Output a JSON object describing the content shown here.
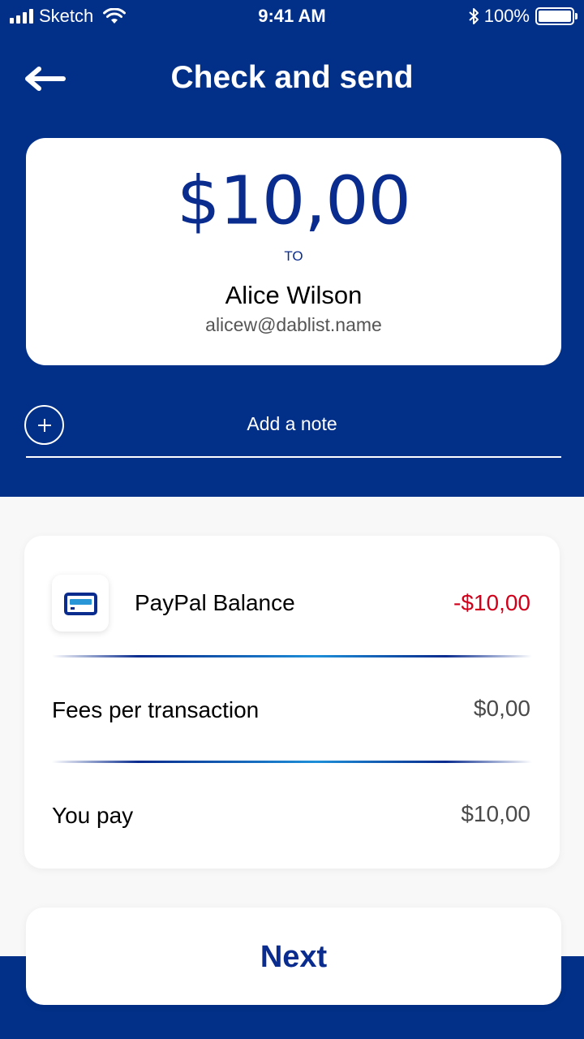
{
  "status_bar": {
    "carrier": "Sketch",
    "time": "9:41 AM",
    "battery": "100%"
  },
  "header": {
    "title": "Check and send",
    "back_icon": "arrow-left-icon"
  },
  "recipient_card": {
    "amount": "$10,00",
    "to_label": "TO",
    "name": "Alice Wilson",
    "email": "alicew@dablist.name"
  },
  "note": {
    "add_icon": "plus-circle-icon",
    "placeholder": "Add a note"
  },
  "payment": {
    "source_icon": "credit-card-icon",
    "source_label": "PayPal Balance",
    "source_amount": "-$10,00",
    "fees_label": "Fees per transaction",
    "fees_amount": "$0,00",
    "total_label": "You pay",
    "total_amount": "$10,00"
  },
  "actions": {
    "next_label": "Next"
  },
  "colors": {
    "primary": "#023088",
    "accent_text": "#0a2c8f",
    "negative": "#d0021b",
    "divider_light": "#1e8fd8"
  }
}
